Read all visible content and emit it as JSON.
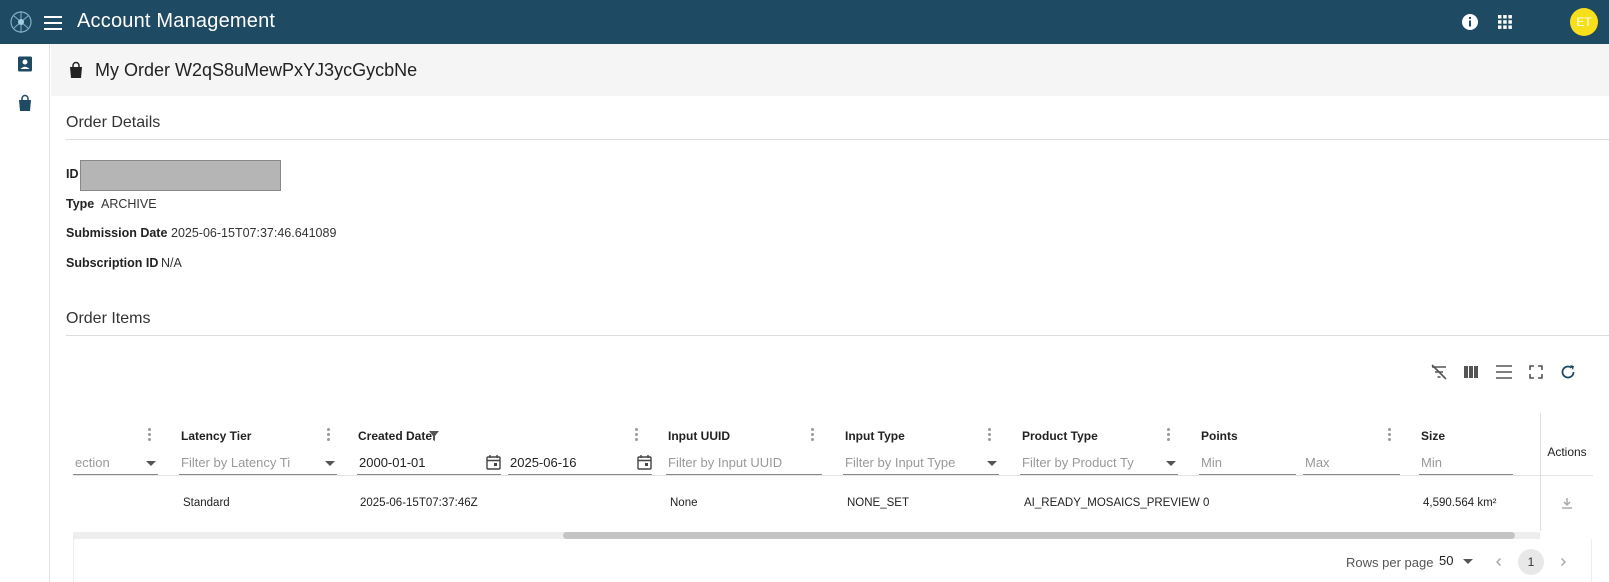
{
  "app": {
    "title": "Account Management",
    "avatar_initials": "ET"
  },
  "topbar_icons": [
    "menu-icon",
    "info-icon",
    "apps-grid-icon"
  ],
  "sidebar": {
    "items": [
      "account-icon",
      "shopping-bag-icon"
    ]
  },
  "page": {
    "title": "My Order W2qS8uMewPxYJ3ycGycbNe"
  },
  "order_details": {
    "section_title": "Order Details",
    "id_label": "ID",
    "type_label": "Type",
    "type_value": "ARCHIVE",
    "submission_label": "Submission Date",
    "submission_value": "2025-06-15T07:37:46.641089",
    "subscription_label": "Subscription ID",
    "subscription_value": "N/A"
  },
  "order_items": {
    "section_title": "Order Items",
    "toolbar": [
      "clear-filters-icon",
      "columns-icon",
      "density-icon",
      "fullscreen-icon",
      "refresh-icon"
    ],
    "columns": {
      "latency": "Latency Tier",
      "created": "Created Date",
      "input_uuid": "Input UUID",
      "input_type": "Input Type",
      "product_type": "Product Type",
      "points": "Points",
      "size": "Size",
      "actions": "Actions"
    },
    "filters": {
      "collection": "ection",
      "latency": "Filter by Latency Ti",
      "created_from": "2000-01-01",
      "created_to": "2025-06-16",
      "input_uuid": "Filter by Input UUID",
      "input_type": "Filter by Input Type",
      "product_type": "Filter by Product Ty",
      "points_min": "Min",
      "points_max": "Max",
      "size_min": "Min"
    },
    "rows": [
      {
        "latency": "Standard",
        "created": "2025-06-15T07:37:46Z",
        "input_uuid": "None",
        "input_type": "NONE_SET",
        "product_type": "AI_READY_MOSAICS_PREVIEW",
        "points": "0",
        "size": "4,590.564 km²"
      }
    ],
    "pagination": {
      "rows_per_page_label": "Rows per page",
      "rows_per_page": "50",
      "current_page": "1"
    }
  }
}
